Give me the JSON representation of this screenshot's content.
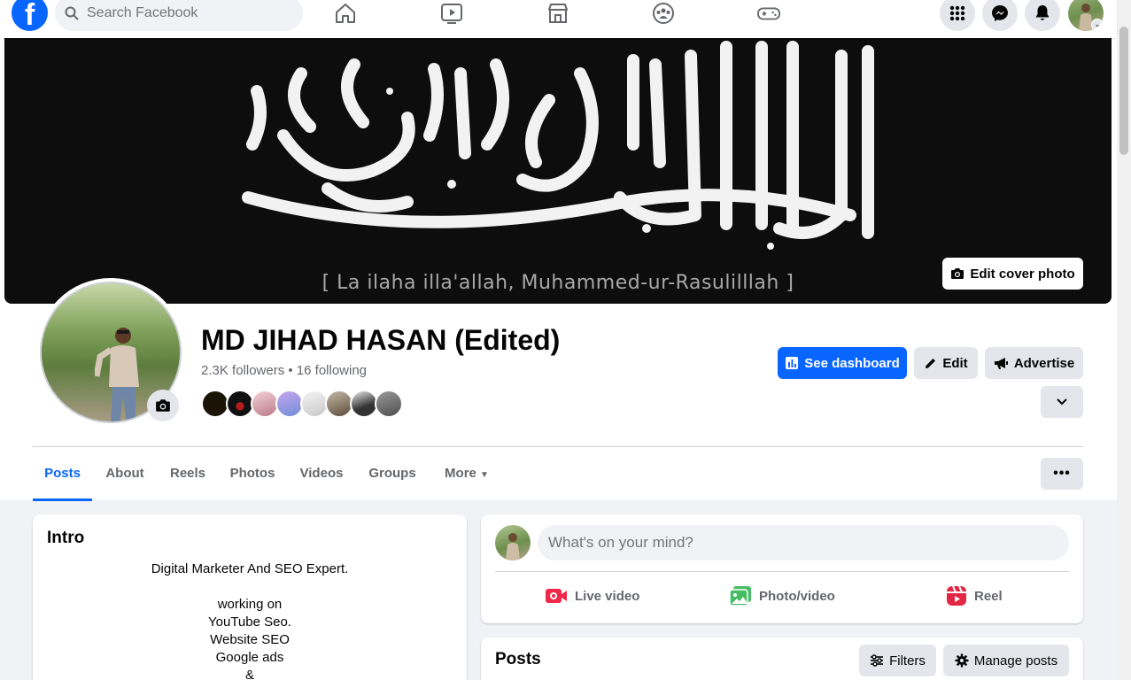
{
  "topbar": {
    "logo_letter": "f",
    "search_placeholder": "Search Facebook",
    "nav_icons": [
      "home-icon",
      "video-icon",
      "marketplace-icon",
      "groups-icon",
      "gaming-icon"
    ],
    "right_icons": [
      "menu-grid-icon",
      "messenger-icon",
      "notifications-icon"
    ]
  },
  "cover": {
    "caption": "[ La ilaha illa'allah, Muhammed-ur-Rasulilllah ]",
    "edit_label": "Edit cover photo"
  },
  "profile": {
    "name": "MD JIHAD HASAN (Edited)",
    "stats": "2.3K followers • 16 following",
    "friend_count_shown": 8
  },
  "actions": {
    "dashboard_label": "See dashboard",
    "edit_label": "Edit",
    "advertise_label": "Advertise"
  },
  "tabs": [
    "Posts",
    "About",
    "Reels",
    "Photos",
    "Videos",
    "Groups",
    "More"
  ],
  "intro": {
    "title": "Intro",
    "bio_lines": [
      "Digital Marketer And SEO Expert.",
      "",
      "working on",
      "YouTube Seo.",
      "Website SEO",
      "Google ads",
      "&"
    ]
  },
  "composer": {
    "placeholder": "What's on your mind?",
    "live_label": "Live video",
    "photo_label": "Photo/video",
    "reel_label": "Reel"
  },
  "posts": {
    "title": "Posts",
    "filters_label": "Filters",
    "manage_label": "Manage posts"
  },
  "colors": {
    "brand": "#0866ff",
    "live": "#f02849",
    "photo": "#45bd62",
    "reel": "#e42645"
  }
}
